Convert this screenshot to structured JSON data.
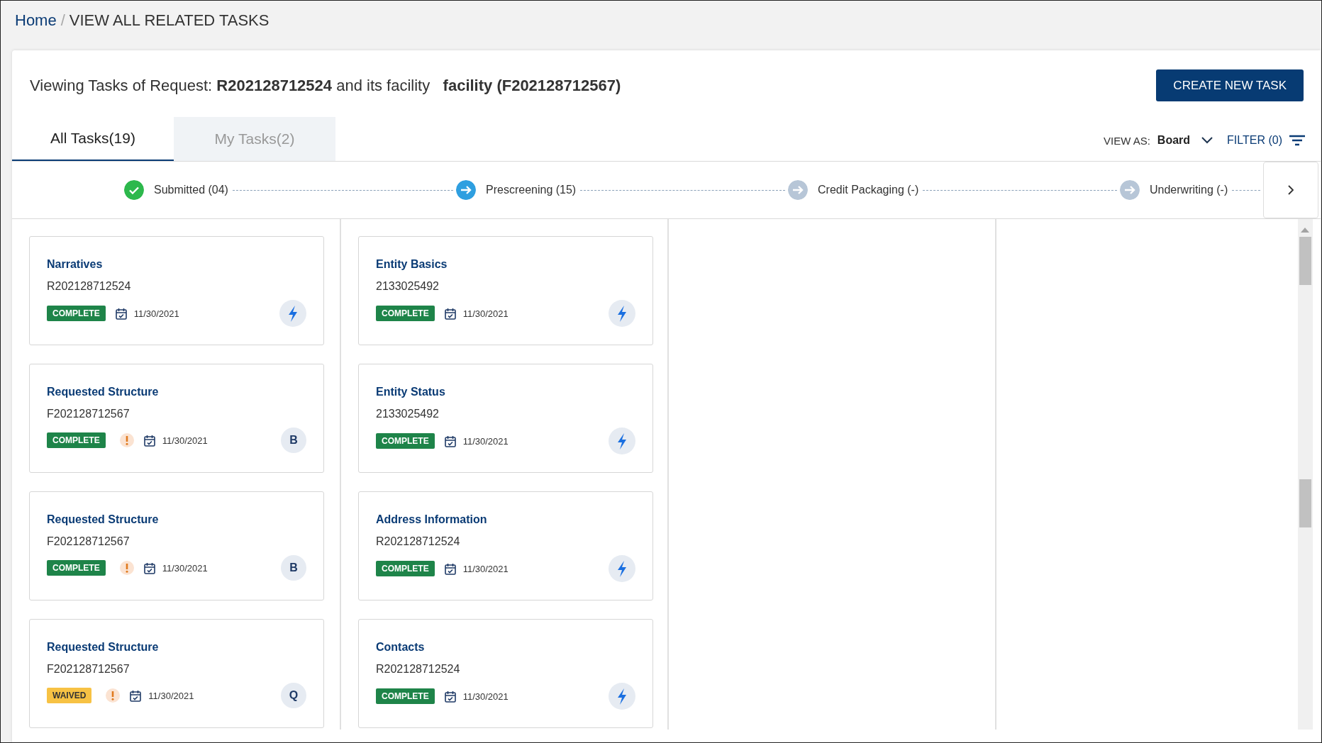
{
  "breadcrumb": {
    "home": "Home",
    "separator": "/",
    "current": "VIEW ALL RELATED TASKS"
  },
  "header": {
    "prefix": "Viewing Tasks of Request:",
    "request": "R202128712524",
    "middle": "and its facility",
    "facility": "facility (F202128712567)",
    "create_button": "CREATE NEW TASK"
  },
  "tabs": [
    {
      "label": "All Tasks(19)",
      "selected": true
    },
    {
      "label": "My Tasks(2)",
      "selected": false
    }
  ],
  "view_as": {
    "label": "VIEW AS:",
    "value": "Board"
  },
  "filter": {
    "label": "FILTER (0)"
  },
  "steps": [
    {
      "label": "Submitted (04)",
      "completed": true,
      "current": false,
      "cards": [
        {
          "title": "Narratives",
          "id": "R202128712524",
          "status": "COMPLETE",
          "waived": false,
          "warning": false,
          "date": "11/30/2021",
          "automated": true
        },
        {
          "title": "Requested Structure",
          "id": "F202128712567",
          "status": "COMPLETE",
          "waived": false,
          "warning": true,
          "date": "11/30/2021",
          "automated": false,
          "assignee": "B"
        },
        {
          "title": "Requested Structure",
          "id": "F202128712567",
          "status": "COMPLETE",
          "waived": false,
          "warning": true,
          "date": "11/30/2021",
          "automated": false,
          "assignee": "B"
        },
        {
          "title": "Requested Structure",
          "id": "F202128712567",
          "status": "WAIVED",
          "waived": true,
          "warning": true,
          "date": "11/30/2021",
          "automated": false,
          "assignee": "Q"
        }
      ]
    },
    {
      "label": "Prescreening (15)",
      "completed": false,
      "current": true,
      "cards": [
        {
          "title": "Entity Basics",
          "id": "2133025492",
          "status": "COMPLETE",
          "waived": false,
          "warning": false,
          "date": "11/30/2021",
          "automated": true
        },
        {
          "title": "Entity Status",
          "id": "2133025492",
          "status": "COMPLETE",
          "waived": false,
          "warning": false,
          "date": "11/30/2021",
          "automated": true
        },
        {
          "title": "Address Information",
          "id": "R202128712524",
          "status": "COMPLETE",
          "waived": false,
          "warning": false,
          "date": "11/30/2021",
          "automated": true
        },
        {
          "title": "Contacts",
          "id": "R202128712524",
          "status": "COMPLETE",
          "waived": false,
          "warning": false,
          "date": "11/30/2021",
          "automated": true
        }
      ]
    },
    {
      "label": "Credit Packaging (-)",
      "completed": false,
      "current": false
    },
    {
      "label": "Underwriting (-)",
      "completed": false,
      "current": false
    }
  ]
}
